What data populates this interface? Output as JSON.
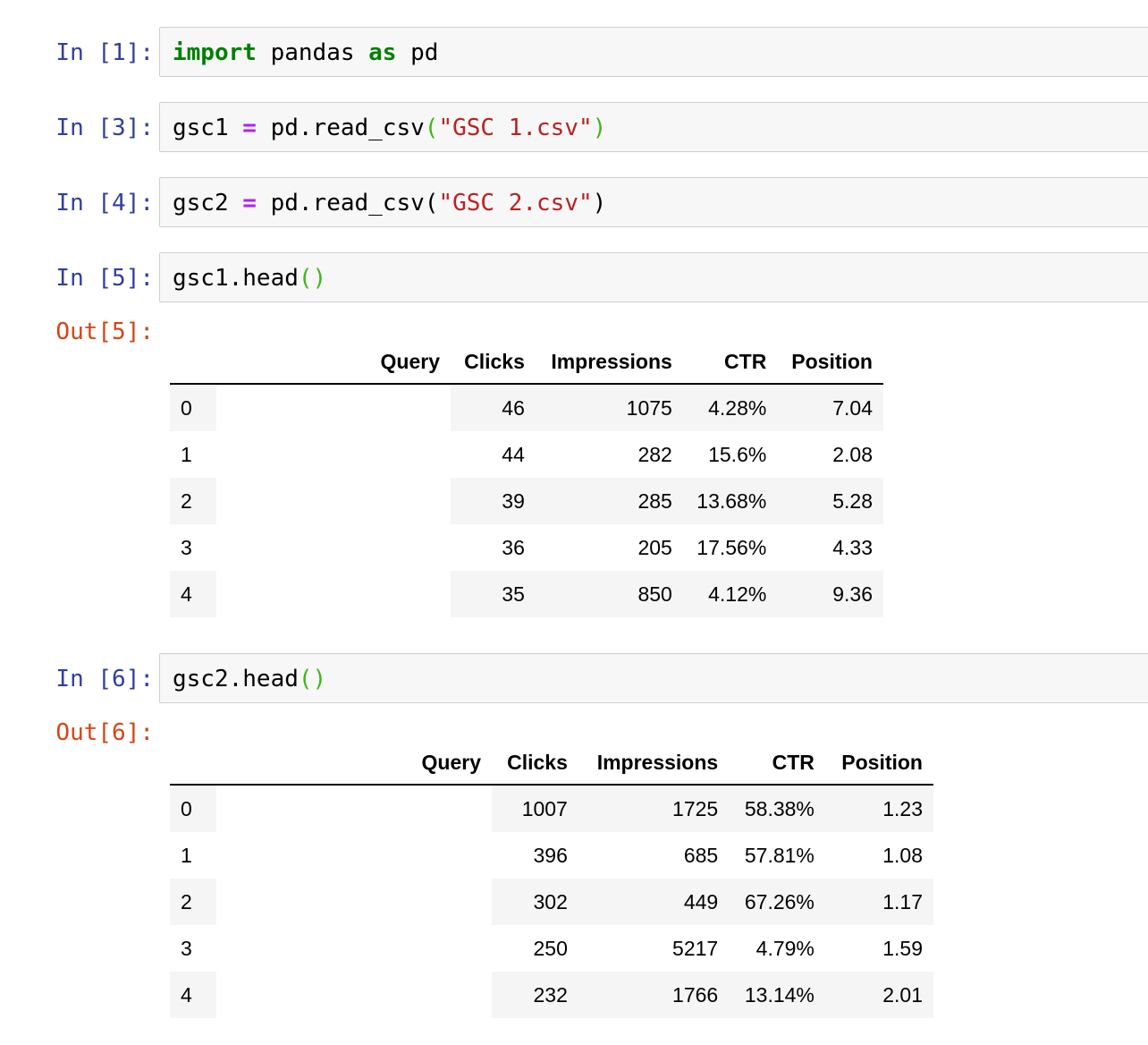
{
  "cells": [
    {
      "prompt": "In [1]:",
      "code": [
        {
          "t": "import",
          "c": "kw"
        },
        {
          "t": " pandas ",
          "c": ""
        },
        {
          "t": "as",
          "c": "kw"
        },
        {
          "t": " pd",
          "c": ""
        }
      ]
    },
    {
      "prompt": "In [3]:",
      "code": [
        {
          "t": "gsc1 ",
          "c": ""
        },
        {
          "t": "=",
          "c": "op"
        },
        {
          "t": " pd.read_csv",
          "c": ""
        },
        {
          "t": "(",
          "c": "pg"
        },
        {
          "t": "\"GSC 1.csv\"",
          "c": "str"
        },
        {
          "t": ")",
          "c": "pg"
        }
      ]
    },
    {
      "prompt": "In [4]:",
      "code": [
        {
          "t": "gsc2 ",
          "c": ""
        },
        {
          "t": "=",
          "c": "op"
        },
        {
          "t": " pd.read_csv(",
          "c": ""
        },
        {
          "t": "\"GSC 2.csv\"",
          "c": "str"
        },
        {
          "t": ")",
          "c": ""
        }
      ]
    },
    {
      "prompt": "In [5]:",
      "code": [
        {
          "t": "gsc1.head",
          "c": ""
        },
        {
          "t": "()",
          "c": "pg"
        }
      ],
      "out_prompt": "Out[5]:"
    },
    {
      "prompt": "In [6]:",
      "code": [
        {
          "t": "gsc2.head",
          "c": ""
        },
        {
          "t": "()",
          "c": "pg"
        }
      ],
      "out_prompt": "Out[6]:"
    }
  ],
  "tables": [
    {
      "columns": [
        "",
        "Query",
        "Clicks",
        "Impressions",
        "CTR",
        "Position"
      ],
      "rows": [
        [
          "0",
          "",
          "46",
          "1075",
          "4.28%",
          "7.04"
        ],
        [
          "1",
          "",
          "44",
          "282",
          "15.6%",
          "2.08"
        ],
        [
          "2",
          "",
          "39",
          "285",
          "13.68%",
          "5.28"
        ],
        [
          "3",
          "",
          "36",
          "205",
          "17.56%",
          "4.33"
        ],
        [
          "4",
          "",
          "35",
          "850",
          "4.12%",
          "9.36"
        ]
      ]
    },
    {
      "columns": [
        "",
        "Query",
        "Clicks",
        "Impressions",
        "CTR",
        "Position"
      ],
      "rows": [
        [
          "0",
          "",
          "1007",
          "1725",
          "58.38%",
          "1.23"
        ],
        [
          "1",
          "",
          "396",
          "685",
          "57.81%",
          "1.08"
        ],
        [
          "2",
          "",
          "302",
          "449",
          "67.26%",
          "1.17"
        ],
        [
          "3",
          "",
          "250",
          "5217",
          "4.79%",
          "1.59"
        ],
        [
          "4",
          "",
          "232",
          "1766",
          "13.14%",
          "2.01"
        ]
      ]
    }
  ]
}
